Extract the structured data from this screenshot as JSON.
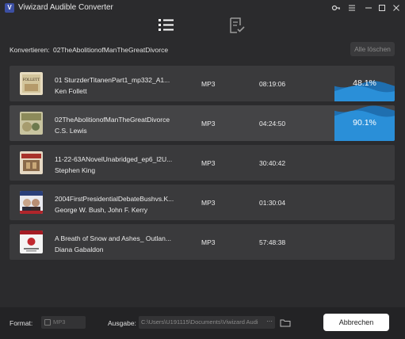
{
  "window": {
    "title": "Viwizard Audible Converter",
    "logo_letter": "V"
  },
  "toolbar": {
    "list_icon": "list-icon",
    "history_icon": "converted-history-icon"
  },
  "status": {
    "label": "Konvertieren:",
    "current_file": "02TheAbolitionofManTheGreatDivorce",
    "clear_all_label": "Alle löschen"
  },
  "items": [
    {
      "title": "01 SturzderTitanenPart1_mp332_A1...",
      "author": "Ken Follett",
      "format": "MP3",
      "duration": "08:19:06",
      "progress_label": "48.1%",
      "progress": 0.481,
      "cover_color": "#d8c9a0"
    },
    {
      "title": "02TheAbolitionofManTheGreatDivorce",
      "author": "C.S. Lewis",
      "format": "MP3",
      "duration": "04:24:50",
      "progress_label": "90.1%",
      "progress": 0.901,
      "cover_color": "#b9b48a"
    },
    {
      "title": "11-22-63ANovelUnabridged_ep6_l2U...",
      "author": "Stephen King",
      "format": "MP3",
      "duration": "30:40:42",
      "cover_color": "#c7b69a"
    },
    {
      "title": "2004FirstPresidentialDebateBushvs.K...",
      "author": "George W. Bush, John F. Kerry",
      "format": "MP3",
      "duration": "01:30:04",
      "cover_color": "#5a6fa8"
    },
    {
      "title": "A Breath of Snow and Ashes_ Outlan...",
      "author": "Diana Gabaldon",
      "format": "MP3",
      "duration": "57:48:38",
      "cover_color": "#f2f2f2"
    }
  ],
  "footer": {
    "format_label": "Format:",
    "format_value": "MP3",
    "output_label": "Ausgabe:",
    "output_path": "C:\\Users\\U191115\\Documents\\Viwizard Audi",
    "more_label": "···",
    "cancel_label": "Abbrechen"
  },
  "colors": {
    "background": "#2b2b2d",
    "row": "#3a3a3c",
    "row_selected": "#444446",
    "progress_fill": "#2a8fd8",
    "progress_fill_light": "#1f6fb0",
    "footer": "#232325"
  }
}
